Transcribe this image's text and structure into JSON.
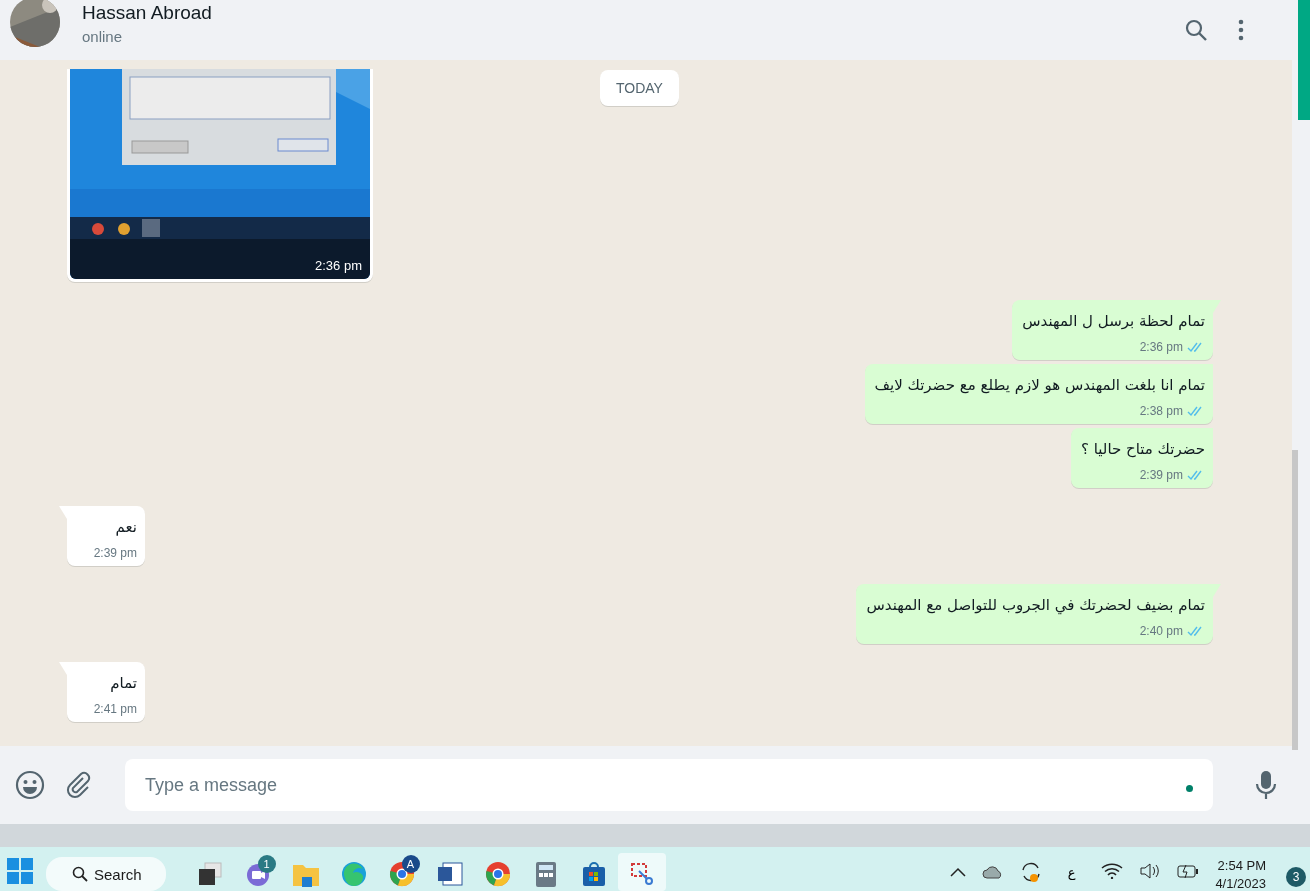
{
  "header": {
    "name": "Hassan Abroad",
    "status": "online"
  },
  "date_chip": "TODAY",
  "messages": [
    {
      "time": "2:36 pm"
    },
    {
      "kind": "out",
      "text": "تمام لحظة برسل ل المهندس",
      "time": "2:36 pm",
      "read": true
    },
    {
      "kind": "out",
      "text": "تمام انا بلغت المهندس هو لازم يطلع مع حضرتك لايف",
      "time": "2:38 pm",
      "read": true
    },
    {
      "kind": "out",
      "text": "حضرتك متاح حاليا ؟",
      "time": "2:39 pm",
      "read": true
    },
    {
      "kind": "in",
      "text": "نعم",
      "time": "2:39 pm"
    },
    {
      "kind": "out",
      "text": "تمام بضيف لحضرتك في الجروب للتواصل مع المهندس",
      "time": "2:40 pm",
      "read": true
    },
    {
      "kind": "in",
      "text": "تمام",
      "time": "2:41 pm"
    }
  ],
  "composer": {
    "placeholder": "Type a message"
  },
  "taskbar": {
    "search": "Search",
    "pinned": [
      {
        "kind": "taskview"
      },
      {
        "kind": "teams",
        "badge": "1"
      },
      {
        "kind": "folder"
      },
      {
        "kind": "edge"
      },
      {
        "kind": "chrome",
        "badge": "A"
      },
      {
        "kind": "word"
      },
      {
        "kind": "chrome-dev"
      },
      {
        "kind": "calculator"
      },
      {
        "kind": "store"
      },
      {
        "kind": "snip",
        "selected": true
      }
    ],
    "keyboard": "ع",
    "time": "2:54 PM",
    "date": "4/1/2023",
    "notifications": "3"
  }
}
